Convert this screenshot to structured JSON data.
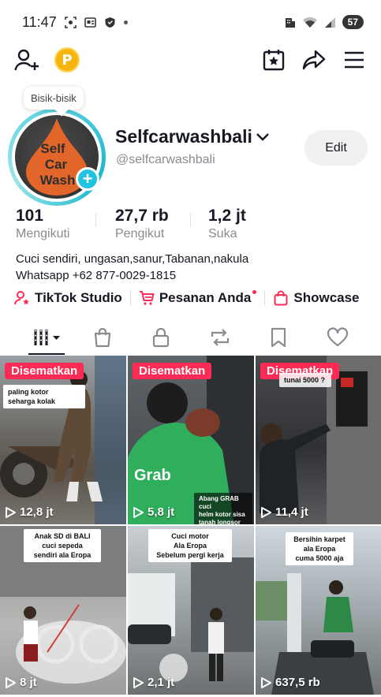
{
  "status_bar": {
    "time": "11:47",
    "battery": "57"
  },
  "profile": {
    "bubble_text": "Bisik-bisik",
    "avatar_logo_lines": [
      "Self",
      "Car",
      "Wash"
    ],
    "display_name": "Selfcarwashbali",
    "username": "@selfcarwashbali",
    "edit_label": "Edit",
    "coin_letter": "P"
  },
  "stats": [
    {
      "value": "101",
      "label": "Mengikuti"
    },
    {
      "value": "27,7 rb",
      "label": "Pengikut"
    },
    {
      "value": "1,2 jt",
      "label": "Suka"
    }
  ],
  "bio": {
    "line1": "Cuci sendiri, ungasan,sanur,Tabanan,nakula",
    "line2": "Whatsapp +62 877-0029-1815"
  },
  "links": {
    "studio": "TikTok Studio",
    "orders": "Pesanan Anda",
    "showcase": "Showcase"
  },
  "videos": [
    {
      "pinned": "Disematkan",
      "caption": "paling kotor\nseharga kolak",
      "views": "12,8 jt"
    },
    {
      "pinned": "Disematkan",
      "caption": "Abang GRAB cuci\nhelm kotor sisa\ntanah longsor",
      "views": "5,8 jt"
    },
    {
      "pinned": "Disematkan",
      "caption": "tunai 5000 ?",
      "views": "11,4 jt"
    },
    {
      "pinned": "",
      "caption": "Anak SD di BALI\ncuci sepeda\nsendiri ala Eropa",
      "views": "8 jt"
    },
    {
      "pinned": "",
      "caption": "Cuci motor\nAla Eropa\nSebelum pergi kerja",
      "views": "2,1 jt"
    },
    {
      "pinned": "",
      "caption": "Bersihin karpet\nala Eropa\ncuma 5000 aja",
      "views": "637,5 rb"
    }
  ],
  "colors": {
    "accent": "#fe2c55",
    "ring": "#20c4e0",
    "muted": "#8a8b91"
  }
}
